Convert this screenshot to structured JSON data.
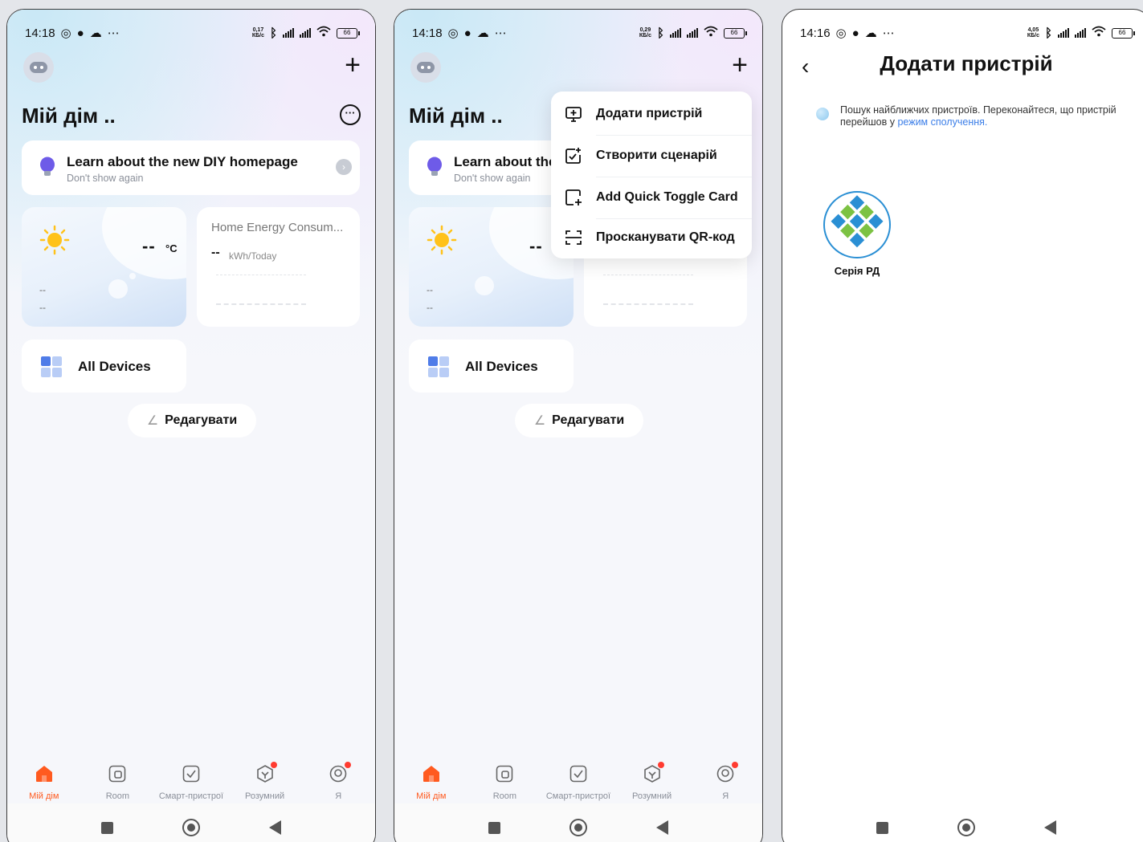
{
  "status_bar": [
    {
      "time": "14:18",
      "speed_top": "0,17",
      "speed_bottom": "КБ/с",
      "battery": "66"
    },
    {
      "time": "14:18",
      "speed_top": "0,29",
      "speed_bottom": "КБ/с",
      "battery": "66"
    },
    {
      "time": "14:16",
      "speed_top": "4,05",
      "speed_bottom": "КБ/с",
      "battery": "66"
    }
  ],
  "home": {
    "title": "Мій дім ..",
    "tip_title": "Learn about the new DIY homepage",
    "tip_title_short": "Learn about the",
    "tip_sub": "Don't show again",
    "weather_temp": "--",
    "weather_unit": "°C",
    "weather_d1": "--",
    "weather_d2": "--",
    "energy_title": "Home Energy Consum...",
    "energy_value": "--",
    "energy_unit": "kWh/Today",
    "all_devices": "All Devices",
    "edit": "Редагувати"
  },
  "tabs": [
    {
      "label": "Мій дім",
      "icon": "home-icon",
      "active": true
    },
    {
      "label": "Room",
      "icon": "room-icon",
      "active": false
    },
    {
      "label": "Смарт-пристрої",
      "icon": "checkbox-icon",
      "active": false
    },
    {
      "label": "Розумний",
      "icon": "smart-icon",
      "active": false
    },
    {
      "label": "Я",
      "icon": "profile-icon",
      "active": false
    }
  ],
  "menu": {
    "items": [
      {
        "label": "Додати пристрій",
        "icon": "add-device-icon"
      },
      {
        "label": "Створити сценарій",
        "icon": "create-scene-icon"
      },
      {
        "label": "Add Quick Toggle Card",
        "icon": "add-card-icon"
      },
      {
        "label": "Просканувати QR-код",
        "icon": "qr-scan-icon"
      }
    ]
  },
  "add_device": {
    "title": "Додати пристрій",
    "search_text": "Пошук найближчих пристроїв. Переконайтеся, що пристрій перейшов у ",
    "search_link": "режим сполучення.",
    "device_name": "Серія РД"
  },
  "colors": {
    "accent": "#ff5a1f",
    "link": "#3b7ee8",
    "badge": "#ff3b30"
  }
}
